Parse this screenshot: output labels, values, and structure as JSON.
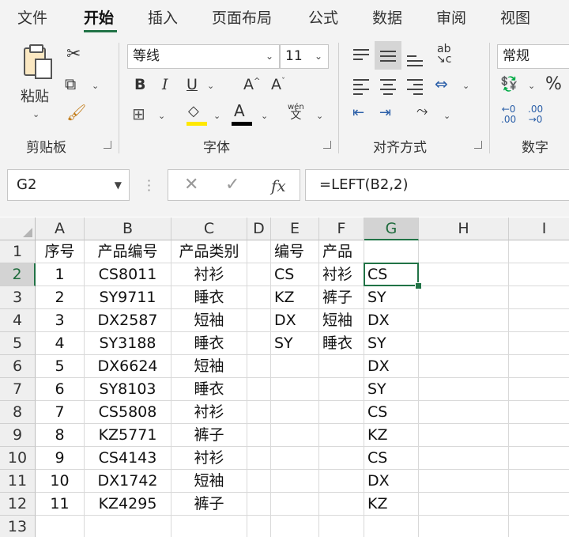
{
  "tabs": [
    "文件",
    "开始",
    "插入",
    "页面布局",
    "公式",
    "数据",
    "审阅",
    "视图"
  ],
  "active_tab": "开始",
  "ribbon": {
    "clipboard": {
      "paste_label": "粘贴",
      "group_label": "剪贴板"
    },
    "font": {
      "font_name": "等线",
      "font_size": "11",
      "group_label": "字体",
      "bold": "B",
      "italic": "I",
      "underline": "U",
      "grow": "A",
      "shrink": "A",
      "phonetic_top": "wén",
      "phonetic_bottom": "文",
      "font_color_letter": "A"
    },
    "alignment": {
      "group_label": "对齐方式"
    },
    "number": {
      "format": "常规",
      "group_label": "数字",
      "percent": "%",
      "inc_top": "←0",
      "inc_bottom": ".00",
      "dec_top": ".00",
      "dec_bottom": "→0"
    },
    "colors": {
      "accent": "#217346",
      "highlight": "#ffe800",
      "font_color": "#000000"
    }
  },
  "formula_bar": {
    "name_box": "G2",
    "formula": "=LEFT(B2,2)",
    "fx": "fx"
  },
  "sheet": {
    "columns": [
      "A",
      "B",
      "C",
      "D",
      "E",
      "F",
      "G",
      "H",
      "I"
    ],
    "rows": [
      "1",
      "2",
      "3",
      "4",
      "5",
      "6",
      "7",
      "8",
      "9",
      "10",
      "11",
      "12",
      "13"
    ],
    "active_cell": "G2",
    "cells": [
      [
        "序号",
        "产品编号",
        "产品类别",
        "",
        "编号",
        "产品",
        ""
      ],
      [
        "1",
        "CS8011",
        "衬衫",
        "",
        "CS",
        "衬衫",
        "CS"
      ],
      [
        "2",
        "SY9711",
        "睡衣",
        "",
        "KZ",
        "裤子",
        "SY"
      ],
      [
        "3",
        "DX2587",
        "短袖",
        "",
        "DX",
        "短袖",
        "DX"
      ],
      [
        "4",
        "SY3188",
        "睡衣",
        "",
        "SY",
        "睡衣",
        "SY"
      ],
      [
        "5",
        "DX6624",
        "短袖",
        "",
        "",
        "",
        "DX"
      ],
      [
        "6",
        "SY8103",
        "睡衣",
        "",
        "",
        "",
        "SY"
      ],
      [
        "7",
        "CS5808",
        "衬衫",
        "",
        "",
        "",
        "CS"
      ],
      [
        "8",
        "KZ5771",
        "裤子",
        "",
        "",
        "",
        "KZ"
      ],
      [
        "9",
        "CS4143",
        "衬衫",
        "",
        "",
        "",
        "CS"
      ],
      [
        "10",
        "DX1742",
        "短袖",
        "",
        "",
        "",
        "DX"
      ],
      [
        "11",
        "KZ4295",
        "裤子",
        "",
        "",
        "",
        "KZ"
      ],
      [
        "",
        "",
        "",
        "",
        "",
        "",
        ""
      ]
    ]
  }
}
